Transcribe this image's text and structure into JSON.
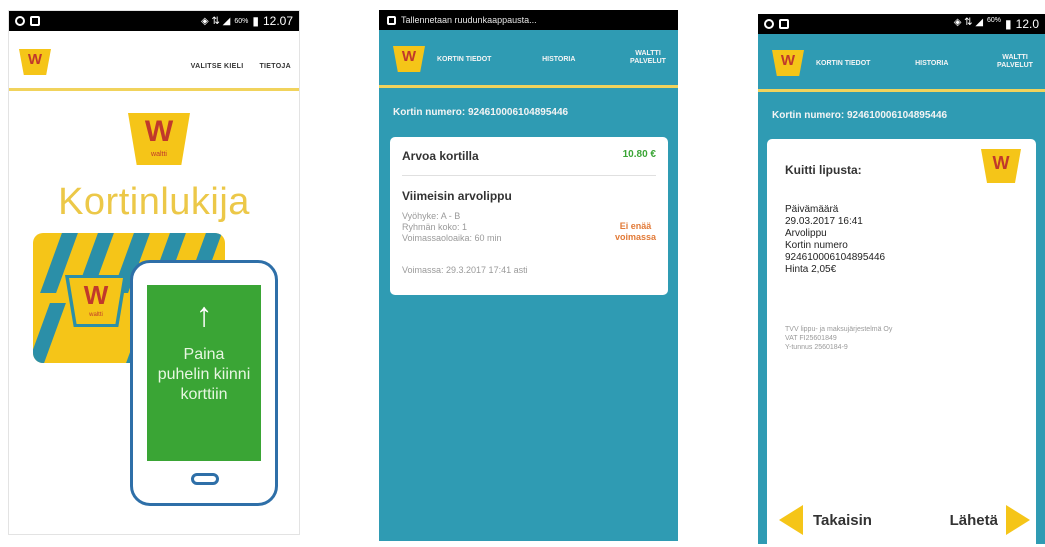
{
  "phone1": {
    "status_time": "12.07",
    "battery": "60%",
    "nav": [
      "VALITSE KIELI",
      "TIETOJA"
    ],
    "logo_letter": "W",
    "logo_sub": "waltti",
    "title": "Kortinlukija",
    "card_logo_letter": "W",
    "card_logo_sub": "waltti",
    "instruction": "Paina puhelin kiinni korttiin"
  },
  "phone2": {
    "status_text": "Tallennetaan ruudunkaappausta...",
    "nav": [
      "KORTIN TIEDOT",
      "HISTORIA",
      "WALTTI PALVELUT"
    ],
    "card_number_label": "Kortin numero: 924610006104895446",
    "balance_label": "Arvoa kortilla",
    "balance_value": "10.80 €",
    "last_ticket_title": "Viimeisin arvolippu",
    "details": [
      "Vyöhyke: A - B",
      "Ryhmän koko: 1",
      "Voimassaoloaika: 60 min"
    ],
    "status": [
      "Ei enää",
      "voimassa"
    ],
    "valid": "Voimassa: 29.3.2017 17:41 asti"
  },
  "phone3": {
    "status_time": "12.0",
    "battery": "60%",
    "nav": [
      "KORTIN TIEDOT",
      "HISTORIA",
      "WALTTI PALVELUT"
    ],
    "card_number_label": "Kortin numero: 924610006104895446",
    "receipt_title": "Kuitti lipusta:",
    "receipt_lines": [
      "Päivämäärä",
      "29.03.2017 16:41",
      "Arvolippu",
      "Kortin numero",
      "924610006104895446",
      "Hinta 2,05€"
    ],
    "company_lines": [
      "TVV lippu- ja maksujärjestelmä Oy",
      "VAT FI25601849",
      "Y-tunnus 2560184-9"
    ],
    "back_label": "Takaisin",
    "send_label": "Lähetä"
  },
  "colors": {
    "brand_yellow": "#f5c518",
    "teal": "#2f9bb3",
    "green": "#3aa535",
    "logo_red": "#c0392b",
    "warning_orange": "#e27a37"
  }
}
